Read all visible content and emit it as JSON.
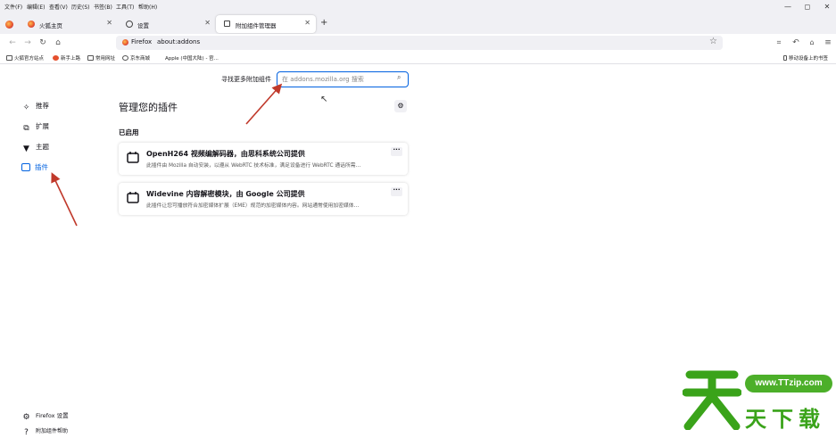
{
  "menu": [
    "文件(F)",
    "编辑(E)",
    "查看(V)",
    "历史(S)",
    "书签(B)",
    "工具(T)",
    "帮助(H)"
  ],
  "window_controls": {
    "minimize": "—",
    "maximize": "◻",
    "close": "✕"
  },
  "tabs": [
    {
      "label": "火狐主页",
      "close": "✕"
    },
    {
      "label": "设置",
      "close": "✕"
    },
    {
      "label": "附加组件管理器",
      "close": "✕"
    }
  ],
  "new_tab": "+",
  "url": {
    "identity": "Firefox",
    "address": "about:addons"
  },
  "bookmarks": [
    "火狐官方站点",
    "新手上路",
    "常用网址",
    "京东商城",
    "Apple (中国大陆) - 官..."
  ],
  "mobile_bookmarks": "移动设备上的书签",
  "search": {
    "label": "寻找更多附加组件",
    "placeholder": "在 addons.mozilla.org 搜索"
  },
  "sidebar": {
    "items": [
      {
        "label": "推荐",
        "active": false
      },
      {
        "label": "扩展",
        "active": false
      },
      {
        "label": "主题",
        "active": false
      },
      {
        "label": "插件",
        "active": true
      }
    ],
    "footer": [
      {
        "label": "Firefox 设置"
      },
      {
        "label": "附加组件帮助"
      }
    ]
  },
  "main": {
    "title": "管理您的插件",
    "section": "已启用",
    "plugins": [
      {
        "name": "OpenH264 视频编解码器，由思科系统公司提供",
        "desc": "此插件由 Mozilla 自动安装，以遵从 WebRTC 技术标准，满足设备进行 WebRTC 通话所需…",
        "more": "···"
      },
      {
        "name": "Widevine 内容解密模块，由 Google 公司提供",
        "desc": "此插件让您可播放符合加密媒体扩展（EME）规范的加密媒体内容。网站通常使用加密媒体…",
        "more": "···"
      }
    ]
  },
  "watermark": {
    "url": "www.TTzip.com",
    "text": "天下载"
  },
  "colors": {
    "accent": "#0061e0",
    "arrow": "#c0392b",
    "watermark": "#3aa31a"
  }
}
